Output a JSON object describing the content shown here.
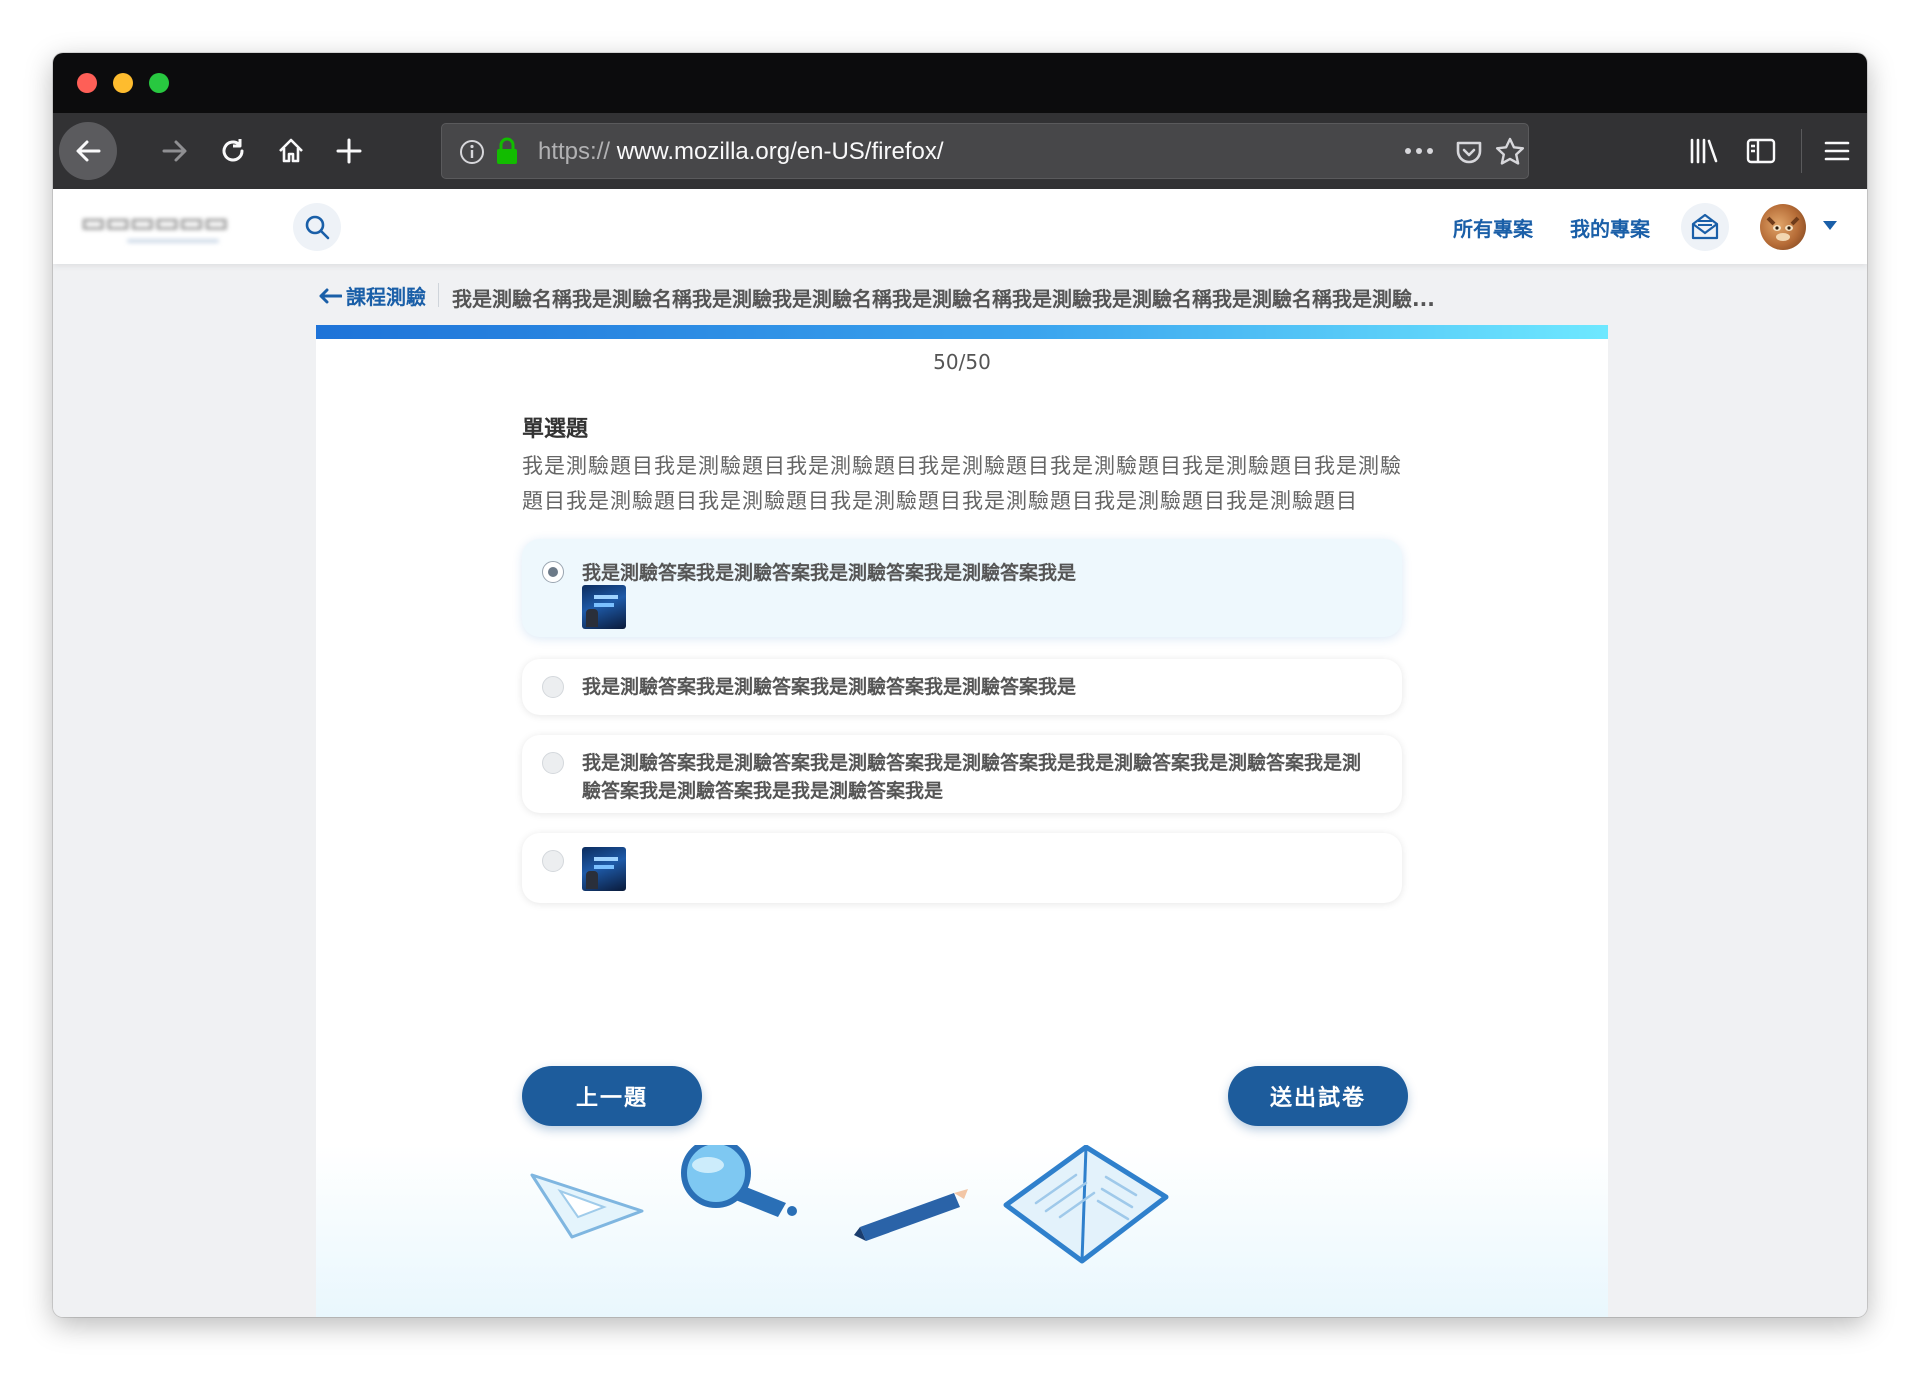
{
  "browser": {
    "url_scheme": "https://",
    "url_host_path": "www.mozilla.org/en-US/firefox/"
  },
  "header": {
    "nav_all_projects": "所有專案",
    "nav_my_projects": "我的專案"
  },
  "breadcrumb": {
    "back_label": "課程測驗",
    "quiz_title": "我是測驗名稱我是測驗名稱我是測驗我是測驗名稱我是測驗名稱我是測驗我是測驗名稱我是測驗名稱我是測驗..."
  },
  "quiz": {
    "progress_fraction": 1.0,
    "counter": "50/50",
    "question_type": "單選題",
    "question_text": "我是測驗題目我是測驗題目我是測驗題目我是測驗題目我是測驗題目我是測驗題目我是測驗題目我是測驗題目我是測驗題目我是測驗題目我是測驗題目我是測驗題目我是測驗題目",
    "options": [
      {
        "text": "我是測驗答案我是測驗答案我是測驗答案我是測驗答案我是",
        "has_image": true,
        "selected": true
      },
      {
        "text": "我是測驗答案我是測驗答案我是測驗答案我是測驗答案我是",
        "has_image": false,
        "selected": false
      },
      {
        "text": "我是測驗答案我是測驗答案我是測驗答案我是測驗答案我是我是測驗答案我是測驗答案我是測驗答案我是測驗答案我是我是測驗答案我是",
        "has_image": false,
        "selected": false
      },
      {
        "text": "",
        "has_image": true,
        "selected": false
      }
    ],
    "prev_button": "上一題",
    "submit_button": "送出試卷"
  },
  "colors": {
    "primary": "#1d5c9c",
    "link": "#1a5fa8",
    "progress_start": "#1e73d8",
    "progress_end": "#6ee8ff",
    "selected_option_bg": "#eef8fd"
  },
  "icons": [
    "back-arrow-icon",
    "forward-arrow-icon",
    "reload-icon",
    "home-icon",
    "new-tab-icon",
    "info-icon",
    "lock-icon",
    "more-icon",
    "pocket-icon",
    "bookmark-star-icon",
    "library-icon",
    "sidebar-icon",
    "hamburger-menu-icon",
    "search-icon",
    "mail-icon",
    "chevron-down-icon",
    "left-arrow-icon"
  ]
}
